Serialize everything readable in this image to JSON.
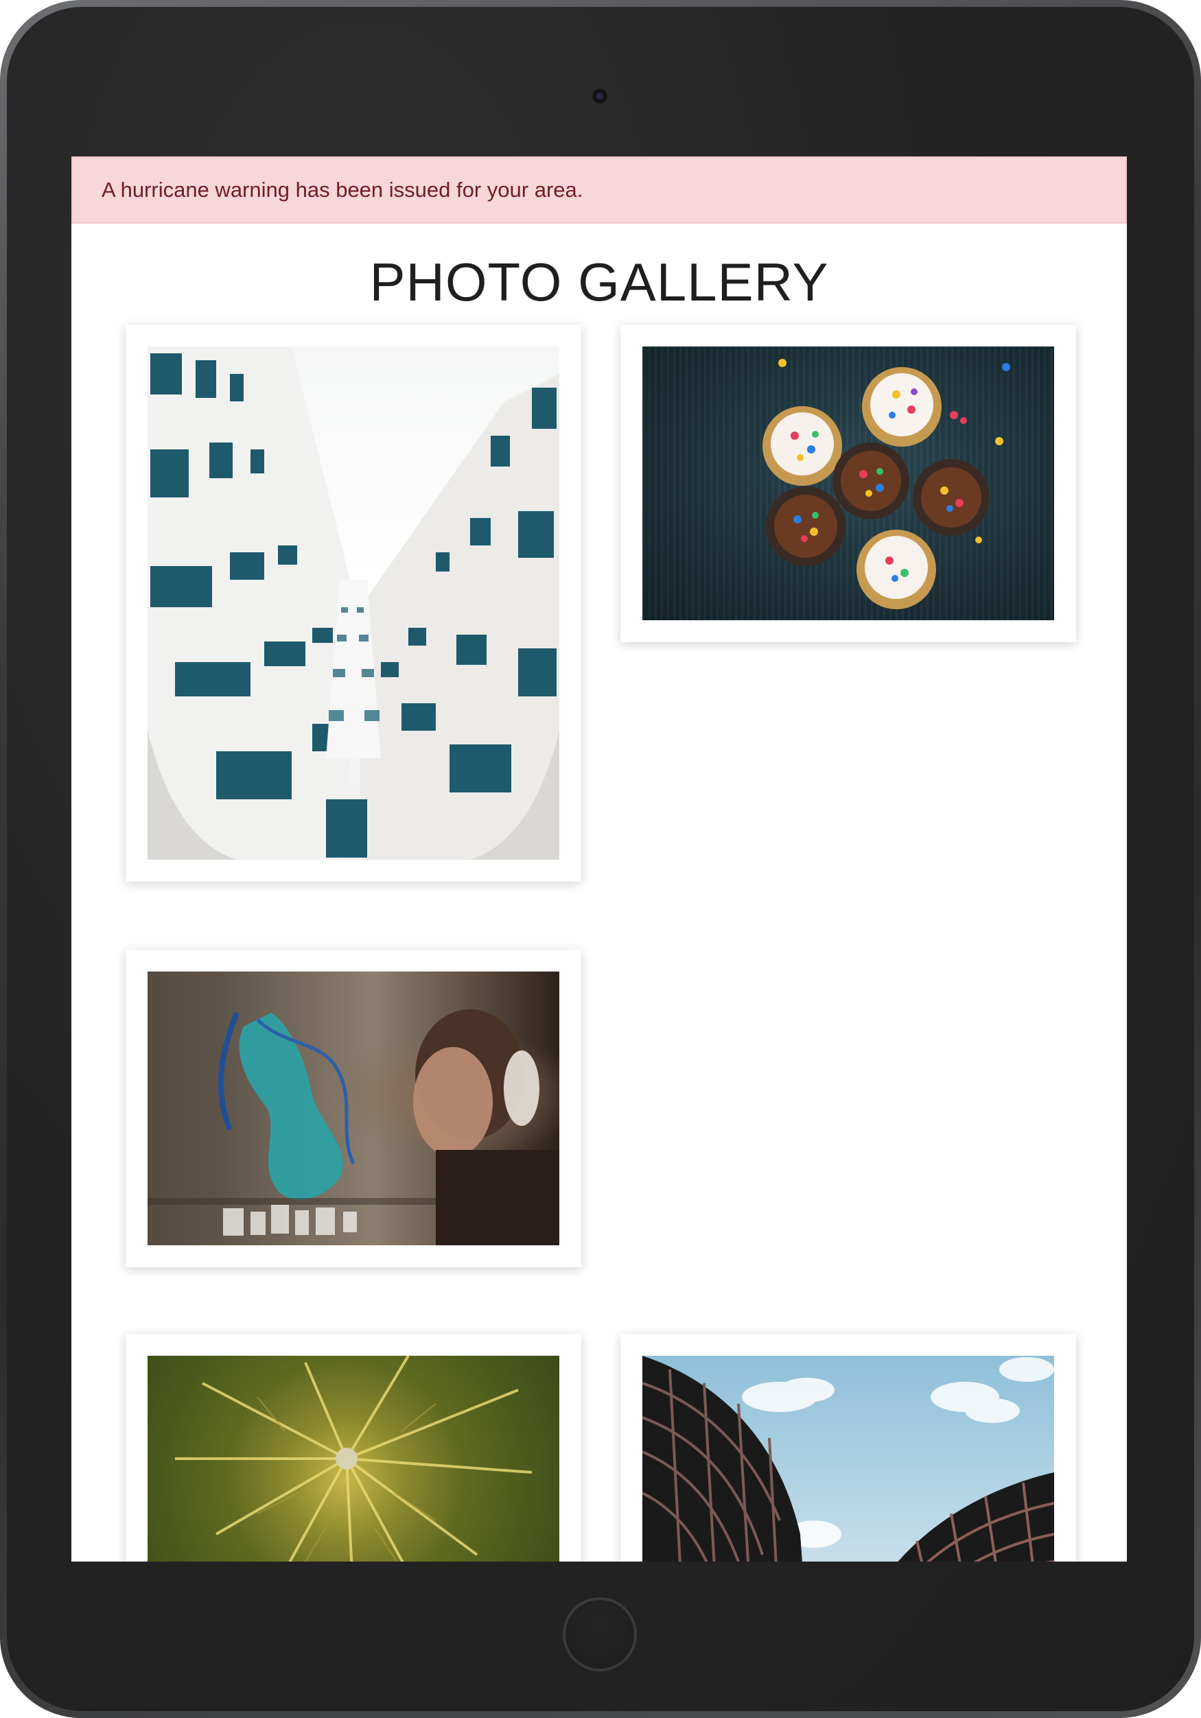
{
  "alert": {
    "message": "A hurricane warning has been issued for your area.",
    "variant": "danger",
    "background": "#f8d7da",
    "text_color": "#721c24"
  },
  "page": {
    "title": "PHOTO GALLERY"
  },
  "gallery": {
    "photos": [
      {
        "subject": "white-building-looking-up"
      },
      {
        "subject": "cupcakes-with-sprinkles"
      },
      {
        "subject": "graffiti-wall-and-girl-with-headphones"
      },
      {
        "subject": "palm-tree-from-above"
      },
      {
        "subject": "black-curved-buildings-and-sky"
      }
    ]
  },
  "device": {
    "frame_color": "#232323",
    "icons": [
      "camera-icon",
      "home-button-icon"
    ]
  }
}
